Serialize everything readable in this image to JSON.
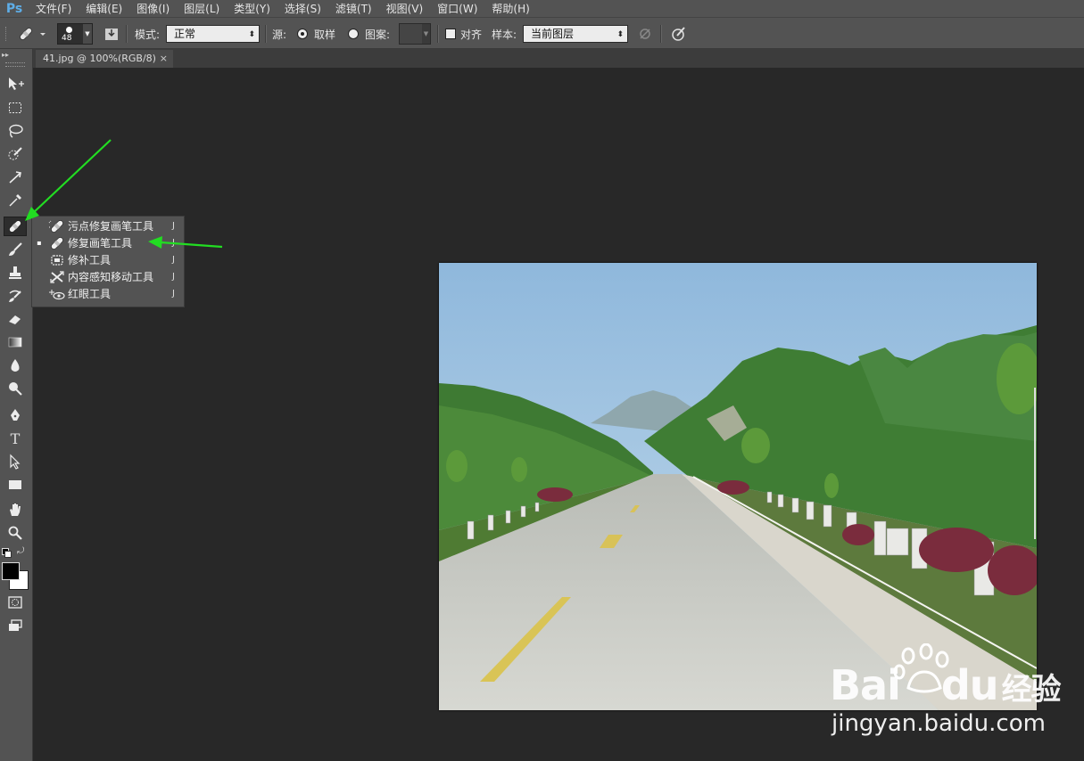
{
  "app": {
    "logo": "Ps"
  },
  "menu": [
    "文件(F)",
    "编辑(E)",
    "图像(I)",
    "图层(L)",
    "类型(Y)",
    "选择(S)",
    "滤镜(T)",
    "视图(V)",
    "窗口(W)",
    "帮助(H)"
  ],
  "options": {
    "brush_size": "48",
    "mode_label": "模式:",
    "mode_value": "正常",
    "source_label": "源:",
    "sampled_label": "取样",
    "pattern_label": "图案:",
    "aligned_label": "对齐",
    "sample_label": "样本:",
    "sample_value": "当前图层"
  },
  "document": {
    "tab_title": "41.jpg @ 100%(RGB/8)",
    "close_glyph": "×"
  },
  "flyout": {
    "items": [
      {
        "label": "污点修复画笔工具",
        "key": "J",
        "selected": false,
        "icon": "spot-healing-brush-icon"
      },
      {
        "label": "修复画笔工具",
        "key": "J",
        "selected": true,
        "icon": "healing-brush-icon"
      },
      {
        "label": "修补工具",
        "key": "J",
        "selected": false,
        "icon": "patch-icon"
      },
      {
        "label": "内容感知移动工具",
        "key": "J",
        "selected": false,
        "icon": "content-aware-move-icon"
      },
      {
        "label": "红眼工具",
        "key": "J",
        "selected": false,
        "icon": "red-eye-icon"
      }
    ],
    "bullet": "▪"
  },
  "tools": [
    "move-icon",
    "marquee-icon",
    "lasso-icon",
    "quick-selection-icon",
    "crop-icon",
    "eyedropper-icon",
    "healing-brush-icon",
    "brush-icon",
    "clone-stamp-icon",
    "history-brush-icon",
    "eraser-icon",
    "gradient-icon",
    "blur-icon",
    "dodge-icon",
    "pen-icon",
    "type-icon",
    "path-selection-icon",
    "rectangle-icon",
    "hand-icon",
    "zoom-icon"
  ],
  "watermark": {
    "brand_a": "Bai",
    "brand_b": "du",
    "brand_cn": "经验",
    "url": "jingyan.baidu.com"
  },
  "colors": {
    "panel": "#535353",
    "canvas": "#282828",
    "arrow": "#22dd22",
    "ps_blue": "#5eaee8"
  }
}
